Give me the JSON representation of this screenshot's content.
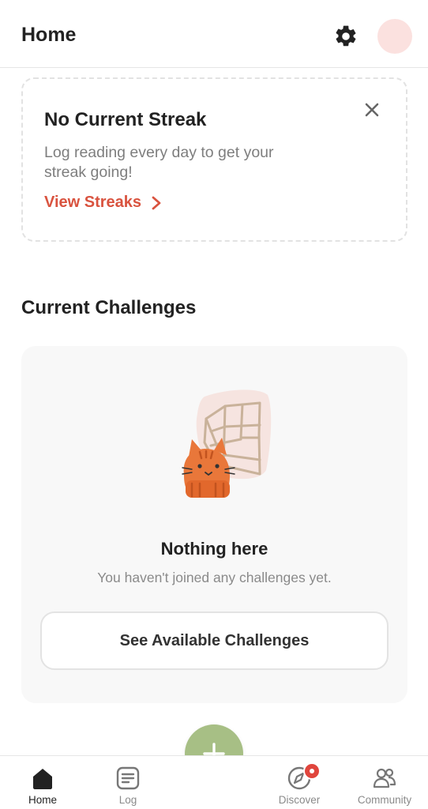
{
  "header": {
    "title": "Home",
    "settings_icon": "gear-icon",
    "avatar_color": "#fbe1df"
  },
  "streak_card": {
    "heading": "No Current Streak",
    "description": "Log reading every day to get your streak going!",
    "link_label": "View Streaks",
    "link_color": "#d9533f"
  },
  "challenges": {
    "section_title": "Current Challenges",
    "empty_title": "Nothing here",
    "empty_subtitle": "You haven't joined any challenges yet.",
    "button_label": "See Available Challenges"
  },
  "fab": {
    "icon": "plus-icon",
    "color": "#a7bf85"
  },
  "bottom_nav": {
    "items": [
      {
        "label": "Home",
        "icon": "home-icon",
        "active": true
      },
      {
        "label": "Log",
        "icon": "log-icon",
        "active": false
      },
      {
        "label": "Discover",
        "icon": "compass-icon",
        "active": false,
        "badge": true
      },
      {
        "label": "Community",
        "icon": "people-icon",
        "active": false
      }
    ]
  }
}
